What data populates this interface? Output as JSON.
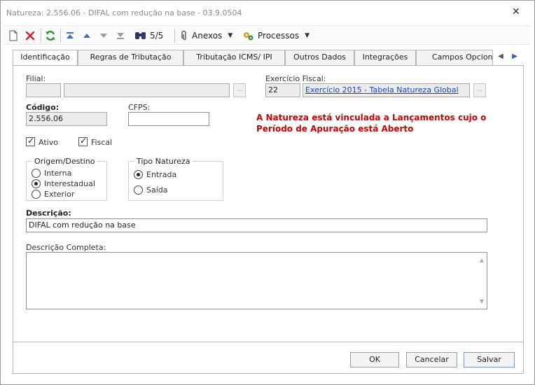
{
  "window": {
    "title": "Natureza: 2.556.06 - DIFAL com redução na base - 03.9.0504",
    "close_glyph": "✕"
  },
  "toolbar": {
    "record_position": "5/5",
    "anexos_label": "Anexos",
    "processos_label": "Processos"
  },
  "tabs": [
    {
      "label": "Identificação",
      "active": true
    },
    {
      "label": "Regras de Tributação"
    },
    {
      "label": "Tributação ICMS/ IPI"
    },
    {
      "label": "Outros Dados"
    },
    {
      "label": "Integrações"
    },
    {
      "label": "Campos Opcionais"
    }
  ],
  "form": {
    "filial_label": "Filial:",
    "filial_code": "",
    "filial_name": "",
    "exercicio_label": "Exercício Fiscal:",
    "exercicio_code": "22",
    "exercicio_name": "Exercício 2015 - Tabela Natureza Global",
    "codigo_label": "Código:",
    "codigo_value": "2.556.06",
    "cfps_label": "CFPS:",
    "cfps_value": "",
    "warning_line1": "A Natureza está vinculada a Lançamentos cujo o",
    "warning_line2": "Período de Apuração está Aberto",
    "ativo_label": "Ativo",
    "ativo_checked": true,
    "fiscal_label": "Fiscal",
    "fiscal_checked": true,
    "origem_title": "Origem/Destino",
    "origem_options": [
      "Interna",
      "Interestadual",
      "Exterior"
    ],
    "origem_selected": "Interestadual",
    "tipo_title": "Tipo Natureza",
    "tipo_options": [
      "Entrada",
      "Saída"
    ],
    "tipo_selected": "Entrada",
    "descricao_label": "Descrição:",
    "descricao_value": "DIFAL com redução na base",
    "descricao_completa_label": "Descrição Completa:",
    "descricao_completa_value": ""
  },
  "buttons": {
    "ok": "OK",
    "cancelar": "Cancelar",
    "salvar": "Salvar"
  },
  "colors": {
    "warning": "#d40000",
    "link": "#1a3fd6"
  }
}
